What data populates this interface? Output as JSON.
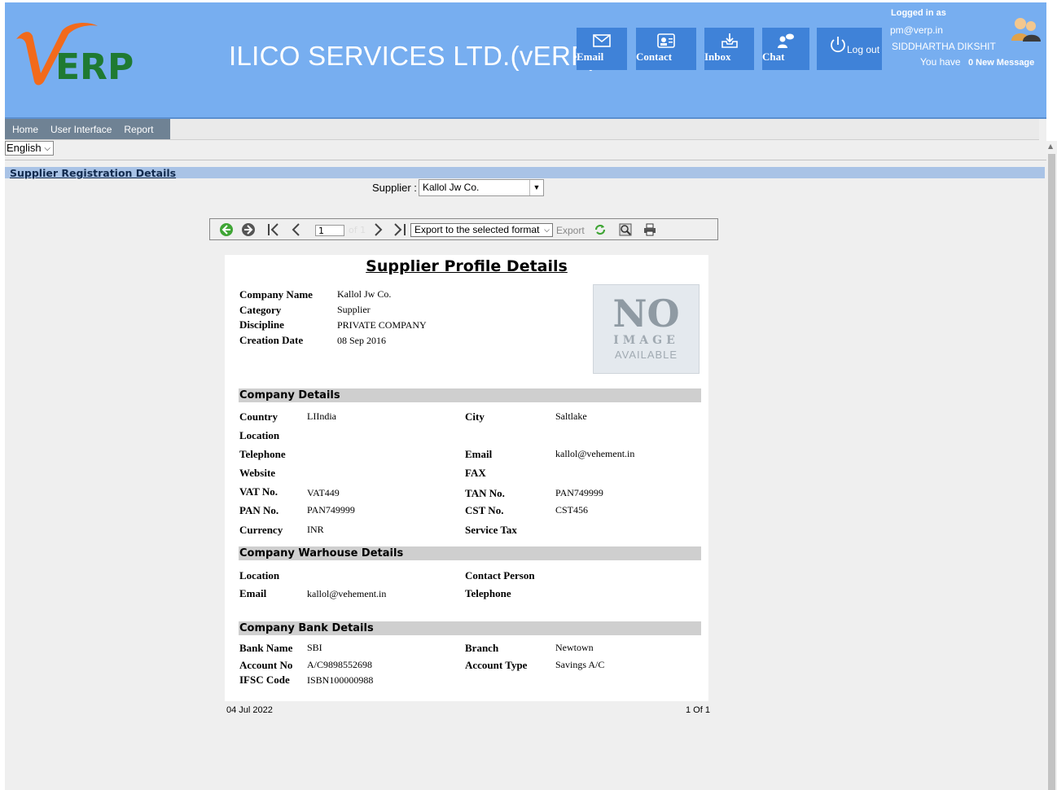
{
  "header": {
    "company_name": "ILICO SERVICES LTD.(vERP)",
    "logo_text": "ERP",
    "buttons": [
      {
        "label": "Email",
        "icon": "envelope-icon"
      },
      {
        "label": "Contact",
        "icon": "contact-card-icon"
      },
      {
        "label": "Inbox",
        "icon": "inbox-icon"
      },
      {
        "label": "Chat",
        "icon": "chat-icon"
      },
      {
        "label": "Log out",
        "icon": "power-icon"
      }
    ],
    "logged_in_label": "Logged in as",
    "user_email": "pm@verp.in",
    "user_name": "SIDDHARTHA DIKSHIT",
    "you_have": "You have",
    "new_message": "0 New Message"
  },
  "menu": [
    "Home",
    "User Interface",
    "Report"
  ],
  "language": "English",
  "section_title": "Supplier Registration Details",
  "supplier": {
    "label": "Supplier :",
    "value": "Kallol Jw Co."
  },
  "toolbar": {
    "page": "1",
    "of_label": "of 1",
    "export_format": "Export to the selected format",
    "export_label": "Export"
  },
  "report": {
    "title": "Supplier Profile Details",
    "profile": [
      {
        "label": "Company Name",
        "value": "Kallol Jw Co."
      },
      {
        "label": "Category",
        "value": "Supplier"
      },
      {
        "label": "Discipline",
        "value": "PRIVATE COMPANY"
      },
      {
        "label": "Creation Date",
        "value": "08 Sep 2016"
      }
    ],
    "no_image": {
      "big": "NO",
      "mid": "IMAGE",
      "small": "AVAILABLE"
    },
    "company_details_title": "Company Details",
    "company_details": {
      "country_label": "Country",
      "country": "LIIndia",
      "city_label": "City",
      "city": "Saltlake",
      "location_label": "Location",
      "location": "",
      "telephone_label": "Telephone",
      "telephone": "",
      "email_label": "Email",
      "email": "kallol@vehement.in",
      "website_label": "Website",
      "website": "",
      "fax_label": "FAX",
      "fax": "",
      "vat_label": "VAT No.",
      "vat": "VAT449",
      "tan_label": "TAN No.",
      "tan": "PAN749999",
      "pan_label": "PAN No.",
      "pan": "PAN749999",
      "cst_label": "CST No.",
      "cst": "CST456",
      "currency_label": "Currency",
      "currency": "INR",
      "service_tax_label": "Service Tax",
      "service_tax": ""
    },
    "warehouse_title": "Company Warhouse Details",
    "warehouse": {
      "location_label": "Location",
      "location": "",
      "contact_label": "Contact Person",
      "contact": "",
      "email_label": "Email",
      "email": "kallol@vehement.in",
      "telephone_label": "Telephone",
      "telephone": ""
    },
    "bank_title": "Company Bank Details",
    "bank": {
      "bank_name_label": "Bank Name",
      "bank_name": "SBI",
      "branch_label": "Branch",
      "branch": "Newtown",
      "account_no_label": "Account No",
      "account_no": "A/C9898552698",
      "account_type_label": "Account Type",
      "account_type": "Savings A/C",
      "ifsc_label": "IFSC Code",
      "ifsc": "ISBN100000988"
    }
  },
  "footer": {
    "date": "04 Jul 2022",
    "page": "1 Of 1"
  }
}
